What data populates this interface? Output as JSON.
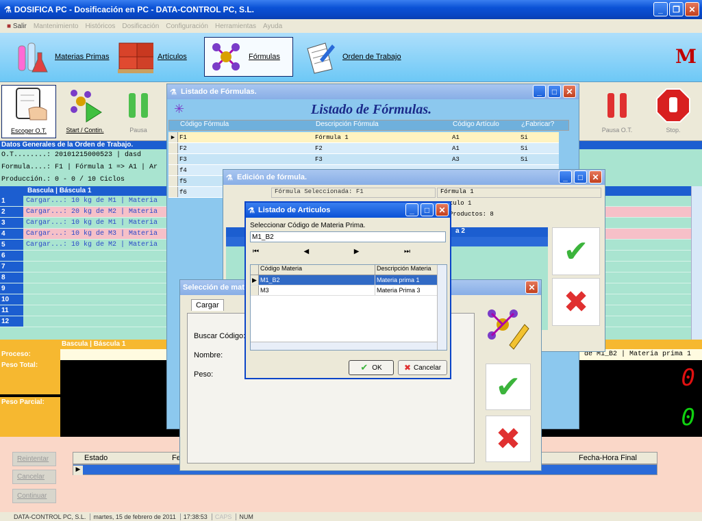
{
  "app": {
    "title": "DOSIFICA PC - Dosificación en PC - DATA-CONTROL PC, S.L."
  },
  "menu": [
    "Salir",
    "Mantenimiento",
    "Históricos",
    "Dosificación",
    "Configuración",
    "Herramientas",
    "Ayuda"
  ],
  "toolbar": {
    "materias": "Materias Primas",
    "articulos": "Artículos",
    "formulas": "Fórmulas",
    "orden": "Orden de Trabajo",
    "logo": "M"
  },
  "controls": {
    "escoger": "Escoger O.T.",
    "start": "Start / Contin.",
    "pausa": "Pausa",
    "pausa_ot": "Pausa O.T.",
    "stop": "Stop."
  },
  "general": {
    "header": "Datos Generales de la Orden de Trabajo.",
    "ot": "O.T........: 20101215000523 | dasd",
    "formula": "Formula....: F1 | Fórmula 1 => A1 | Ar",
    "produccion": "Producción.: 0 - 0 / 10 Ciclos"
  },
  "bascula": {
    "header": "Bascula | Báscula 1",
    "rows": [
      {
        "n": "1",
        "t": "Cargar...: 10 kg de M1 | Materia"
      },
      {
        "n": "2",
        "t": "Cargar...: 20 kg de M2 | Materia"
      },
      {
        "n": "3",
        "t": "Cargar...: 10 kg de M1 | Materia"
      },
      {
        "n": "4",
        "t": "Cargar...: 10 kg de M3 | Materia"
      },
      {
        "n": "5",
        "t": "Cargar...: 10 kg de M2 | Materia"
      },
      {
        "n": "6",
        "t": ""
      },
      {
        "n": "7",
        "t": ""
      },
      {
        "n": "8",
        "t": ""
      },
      {
        "n": "9",
        "t": ""
      },
      {
        "n": "10",
        "t": ""
      },
      {
        "n": "11",
        "t": ""
      },
      {
        "n": "12",
        "t": ""
      }
    ],
    "bottom_header": "Bascula | Báscula 1",
    "proceso": "Proceso:",
    "peso_total": "Peso Total:",
    "peso_parcial": "Peso Parcial:",
    "right_text": "de M1_B2 | Materia prima 1",
    "digit1": "0",
    "digit2": "0"
  },
  "bottom": {
    "reintentar": "Reintentar",
    "cancelar": "Cancelar",
    "continuar": "Continuar",
    "col_estado": "Estado",
    "col_fe": "Fe",
    "col_final": "Fecha-Hora Final"
  },
  "listado_formulas": {
    "title": "Listado de Fórmulas.",
    "heading": "Listado de Fórmulas.",
    "columns": [
      "Código Fórmula",
      "Descripción Fórmula",
      "Código Artículo",
      "¿Fabricar?"
    ],
    "rows": [
      {
        "c": "F1",
        "d": "Fórmula 1",
        "a": "A1",
        "f": "Si"
      },
      {
        "c": "F2",
        "d": "F2",
        "a": "A1",
        "f": "Si"
      },
      {
        "c": "F3",
        "d": "F3",
        "a": "A3",
        "f": "Si"
      },
      {
        "c": "f4",
        "d": "",
        "a": "",
        "f": ""
      },
      {
        "c": "f5",
        "d": "",
        "a": "",
        "f": ""
      },
      {
        "c": "f6",
        "d": "",
        "a": "",
        "f": ""
      }
    ]
  },
  "edicion": {
    "title": "Edición de fórmula.",
    "sel": "Fórmula Seleccionada: F1",
    "formula": "Fórmula 1",
    "articulo": "culo 1",
    "productos": "Productos: 8",
    "col": "a 2"
  },
  "seleccion": {
    "title": "Selección de mat",
    "tab": "Cargar",
    "buscar": "Buscar Código:",
    "nombre": "Nombre:",
    "peso": "Peso:"
  },
  "articulos": {
    "title": "Listado de Articulos",
    "label": "Seleccionar Código de Materia Prima.",
    "input": "M1_B2",
    "columns": [
      "Código Materia",
      "Descripción Materia"
    ],
    "rows": [
      {
        "c": "M1_B2",
        "d": "Materia prima 1"
      },
      {
        "c": "M3",
        "d": "Materia Prima 3"
      }
    ],
    "ok": "OK",
    "cancel": "Cancelar"
  },
  "status": {
    "company": "DATA-CONTROL PC, S.L.",
    "date": "martes, 15 de febrero de 2011",
    "time": "17:38:53",
    "caps": "CAPS",
    "num": "NUM"
  }
}
